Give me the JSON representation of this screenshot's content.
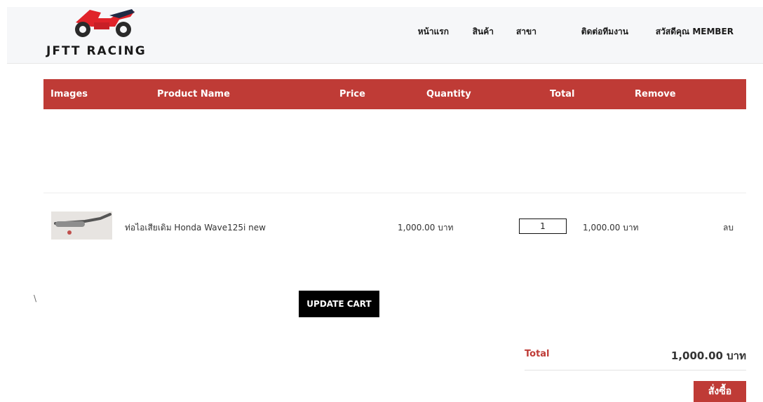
{
  "brand": {
    "name": "JFTT RACING",
    "primary_color": "#bf3b36",
    "logo_icon": "motorcycle-icon"
  },
  "nav": {
    "items": [
      "หน้าแรก",
      "สินค้า",
      "สาขา",
      "ติดต่อทีมงาน",
      "สวัสดีคุณ MEMBER"
    ]
  },
  "cart": {
    "columns": [
      "Images",
      "Product Name",
      "Price",
      "Quantity",
      "Total",
      "Remove"
    ],
    "items": [
      {
        "image_icon": "exhaust-pipe-image",
        "name": "ท่อไอเสียเดิม Honda Wave125i new",
        "price": "1,000.00 บาท",
        "quantity": "1",
        "total": "1,000.00 บาท",
        "remove": "ลบ"
      }
    ],
    "stray_text": "\\",
    "update_label": "UPDATE CART",
    "total_label": "Total",
    "total_value": "1,000.00 บาท",
    "order_label": "สั่งซื้อ"
  }
}
